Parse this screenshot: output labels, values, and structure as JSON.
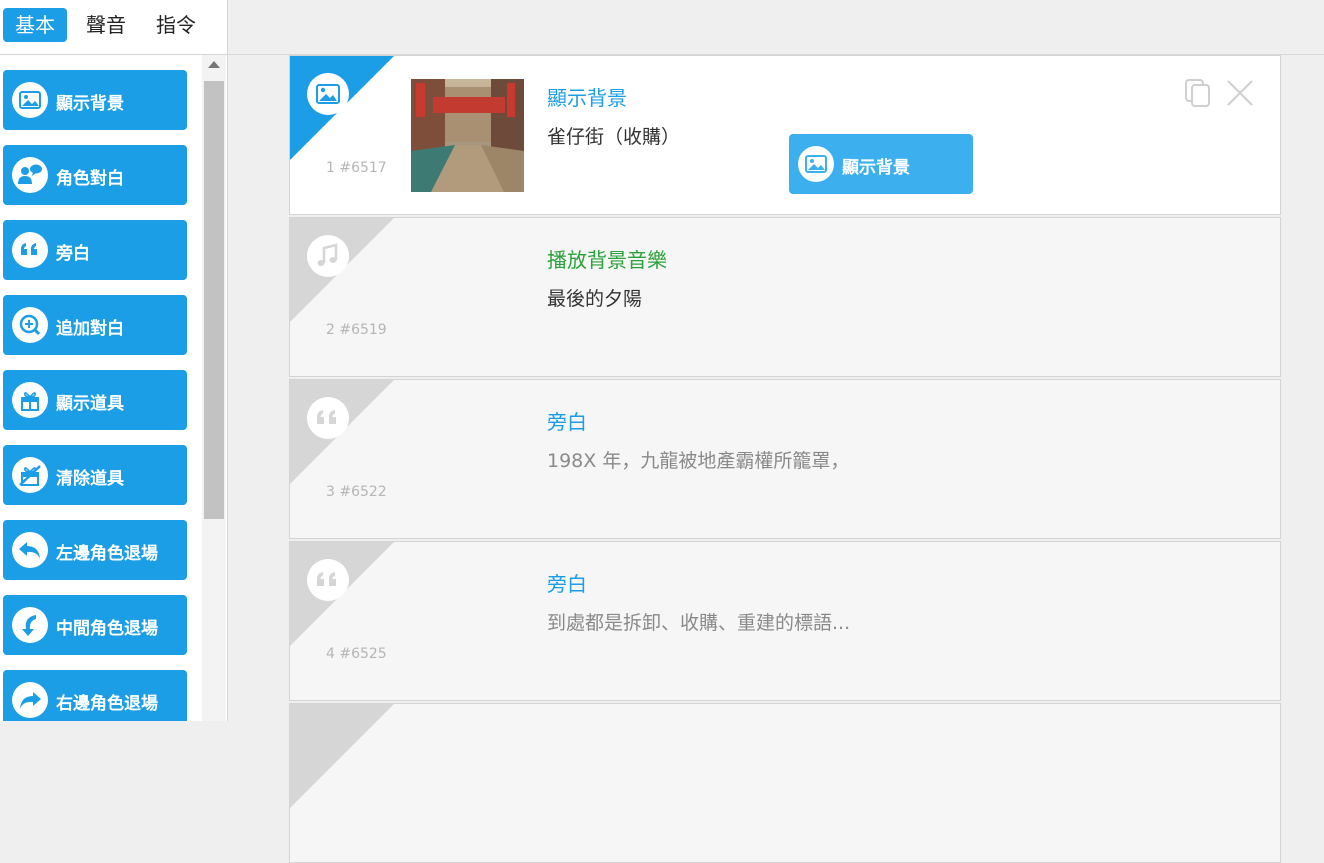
{
  "tabs": [
    {
      "label": "基本"
    },
    {
      "label": "聲音"
    },
    {
      "label": "指令"
    }
  ],
  "commands": [
    {
      "label": "顯示背景",
      "icon": "image-icon"
    },
    {
      "label": "角色對白",
      "icon": "user-chat-icon"
    },
    {
      "label": "旁白",
      "icon": "quote-icon"
    },
    {
      "label": "追加對白",
      "icon": "add-chat-icon"
    },
    {
      "label": "顯示道具",
      "icon": "gift-icon"
    },
    {
      "label": "清除道具",
      "icon": "gift-off-icon"
    },
    {
      "label": "左邊角色退場",
      "icon": "arrow-back-left-icon"
    },
    {
      "label": "中間角色退場",
      "icon": "arrow-down-curve-icon"
    },
    {
      "label": "右邊角色退場",
      "icon": "arrow-forward-right-icon"
    }
  ],
  "cards": [
    {
      "index": "1 #6517",
      "title": "顯示背景",
      "subtitle": "雀仔街（收購）",
      "icon": "image-icon",
      "title_color": "#1b9ee6",
      "action_label": "顯示背景"
    },
    {
      "index": "2 #6519",
      "title": "播放背景音樂",
      "subtitle": "最後的夕陽",
      "icon": "music-icon",
      "title_color": "#2aa13a"
    },
    {
      "index": "3 #6522",
      "title": "旁白",
      "subtitle": "198X 年，九龍被地產霸權所籠罩，",
      "icon": "quote-icon",
      "title_color": "#1b9ee6"
    },
    {
      "index": "4 #6525",
      "title": "旁白",
      "subtitle": "到處都是拆卸、收購、重建的標語...",
      "icon": "quote-icon",
      "title_color": "#1b9ee6"
    }
  ],
  "colors": {
    "accent": "#1b9ee6",
    "accent_light": "#3cb0ee",
    "music_green": "#2aa13a"
  }
}
